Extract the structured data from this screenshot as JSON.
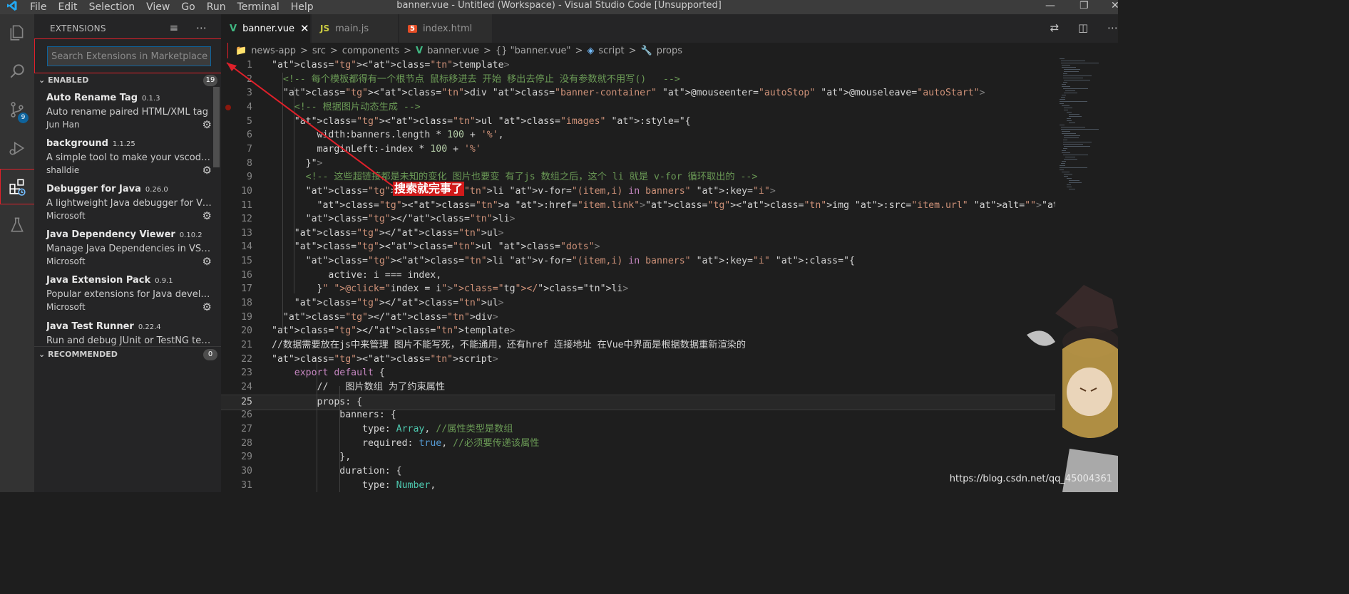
{
  "window": {
    "title": "banner.vue - Untitled (Workspace) - Visual Studio Code [Unsupported]",
    "menu": [
      "File",
      "Edit",
      "Selection",
      "View",
      "Go",
      "Run",
      "Terminal",
      "Help"
    ]
  },
  "activity_bar": {
    "source_control_badge": "9"
  },
  "sidebar": {
    "title": "EXTENSIONS",
    "search_placeholder": "Search Extensions in Marketplace",
    "enabled": {
      "label": "ENABLED",
      "count": "19",
      "items": [
        {
          "name": "Auto Rename Tag",
          "version": "0.1.3",
          "description": "Auto rename paired HTML/XML tag",
          "publisher": "Jun Han"
        },
        {
          "name": "background",
          "version": "1.1.25",
          "description": "A simple tool to make your vscode's ...",
          "publisher": "shalldie"
        },
        {
          "name": "Debugger for Java",
          "version": "0.26.0",
          "description": "A lightweight Java debugger for Visu...",
          "publisher": "Microsoft"
        },
        {
          "name": "Java Dependency Viewer",
          "version": "0.10.2",
          "description": "Manage Java Dependencies in VSCode",
          "publisher": "Microsoft"
        },
        {
          "name": "Java Extension Pack",
          "version": "0.9.1",
          "description": "Popular extensions for Java develop...",
          "publisher": "Microsoft"
        },
        {
          "name": "Java Test Runner",
          "version": "0.22.4",
          "description": "Run and debug JUnit or TestNG test c...",
          "publisher": ""
        }
      ]
    },
    "recommended": {
      "label": "RECOMMENDED",
      "count": "0"
    }
  },
  "tabs": [
    {
      "icon": "V",
      "label": "banner.vue",
      "active": true
    },
    {
      "icon": "JS",
      "label": "main.js",
      "active": false
    },
    {
      "icon": "5",
      "label": "index.html",
      "active": false
    }
  ],
  "breadcrumb": [
    "news-app",
    "src",
    "components",
    "banner.vue",
    "{} \"banner.vue\"",
    "script",
    "props"
  ],
  "annotation": "搜索就完事了",
  "watermark": "https://blog.csdn.net/qq_45004361",
  "code_lines": [
    {
      "n": "1",
      "t": "<template>"
    },
    {
      "n": "2",
      "t": "  <!-- 每个模板都得有一个根节点 鼠标移进去 开始 移出去停止 没有参数就不用写()   -->"
    },
    {
      "n": "3",
      "t": "  <div class=\"banner-container\" @mouseenter=\"autoStop\" @mouseleave=\"autoStart\">"
    },
    {
      "n": "4",
      "t": "    <!-- 根据图片动态生成 -->"
    },
    {
      "n": "5",
      "t": "    <ul class=\"images\" :style=\"{"
    },
    {
      "n": "6",
      "t": "        width:banners.length * 100 + '%',"
    },
    {
      "n": "7",
      "t": "        marginLeft:-index * 100 + '%'"
    },
    {
      "n": "8",
      "t": "      }\">"
    },
    {
      "n": "9",
      "t": "      <!-- 这些超链接都是未知的变化 图片也要变 有了js 数组之后，这个 li 就是 v-for 循环取出的 -->"
    },
    {
      "n": "10",
      "t": "      <li v-for=\"(item,i) in banners\" :key=\"i\">"
    },
    {
      "n": "11",
      "t": "        <a :href=\"item.link\"><img :src=\"item.url\" alt=\"\"></a>"
    },
    {
      "n": "12",
      "t": "      </li>"
    },
    {
      "n": "13",
      "t": "    </ul>"
    },
    {
      "n": "14",
      "t": "    <ul class=\"dots\">"
    },
    {
      "n": "15",
      "t": "      <li v-for=\"(item,i) in banners\" :key=\"i\" :class=\"{"
    },
    {
      "n": "16",
      "t": "          active: i === index,"
    },
    {
      "n": "17",
      "t": "        }\" @click=\"index = i\"></li>"
    },
    {
      "n": "18",
      "t": "    </ul>"
    },
    {
      "n": "19",
      "t": "  </div>"
    },
    {
      "n": "20",
      "t": "</template>"
    },
    {
      "n": "21",
      "t": "//数据需要放在js中来管理 图片不能写死，不能通用，还有href 连接地址 在Vue中界面是根据数据重新渲染的"
    },
    {
      "n": "22",
      "t": "<script>"
    },
    {
      "n": "23",
      "t": "    export default {"
    },
    {
      "n": "24",
      "t": "        //   图片数组 为了约束属性"
    },
    {
      "n": "25",
      "t": "        props: {"
    },
    {
      "n": "26",
      "t": "            banners: {"
    },
    {
      "n": "27",
      "t": "                type: Array, //属性类型是数组"
    },
    {
      "n": "28",
      "t": "                required: true, //必须要传递该属性"
    },
    {
      "n": "29",
      "t": "            },"
    },
    {
      "n": "30",
      "t": "            duration: {"
    },
    {
      "n": "31",
      "t": "                type: Number,"
    }
  ]
}
